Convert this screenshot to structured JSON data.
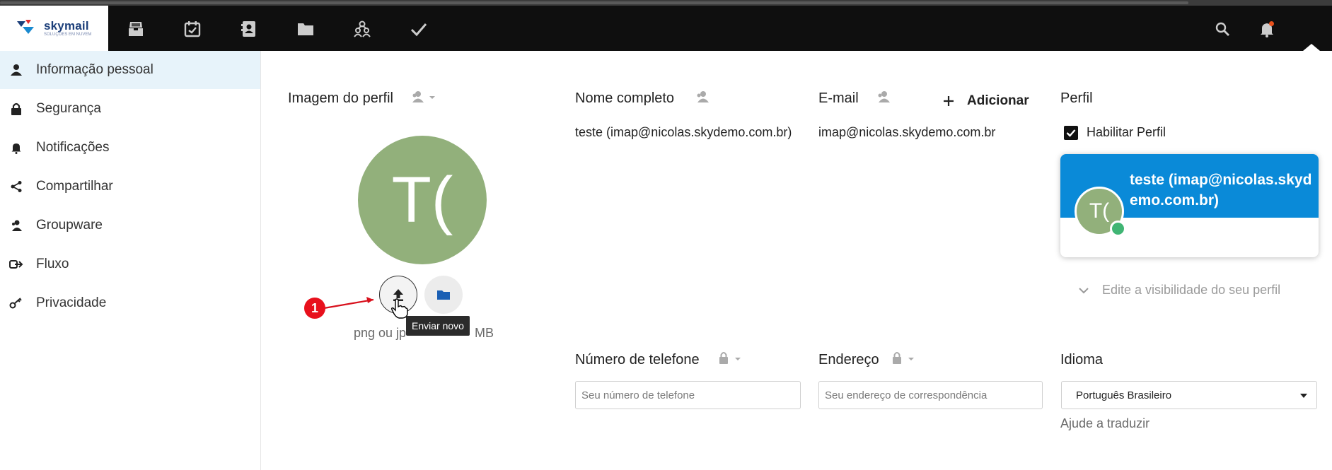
{
  "app": {
    "logo_text": "skymail",
    "logo_subtext": "SOLUÇÕES EM NUVEM"
  },
  "header": {
    "nav_icons": [
      "mail-icon",
      "calendar-icon",
      "contacts-icon",
      "files-icon",
      "groups-icon",
      "tasks-icon"
    ],
    "right_icons": [
      "search-icon",
      "notifications-icon"
    ],
    "notification_dot_color": "#e8511c"
  },
  "sidebar": {
    "items": [
      {
        "label": "Informação pessoal",
        "icon": "user-icon",
        "active": true
      },
      {
        "label": "Segurança",
        "icon": "lock-icon"
      },
      {
        "label": "Notificações",
        "icon": "bell-icon"
      },
      {
        "label": "Compartilhar",
        "icon": "share-icon"
      },
      {
        "label": "Groupware",
        "icon": "groupware-icon"
      },
      {
        "label": "Fluxo",
        "icon": "flow-icon"
      },
      {
        "label": "Privacidade",
        "icon": "key-icon"
      }
    ]
  },
  "profile_image": {
    "label": "Imagem do perfil",
    "avatar_initials": "T(",
    "avatar_color": "#92b07b",
    "upload_tooltip": "Enviar novo",
    "hint_left": "png ou jp",
    "hint_right": "MB",
    "annotation_number": "1"
  },
  "full_name": {
    "label": "Nome completo",
    "value": "teste (imap@nicolas.skydemo.com.br)"
  },
  "email": {
    "label": "E-mail",
    "add_label": "Adicionar",
    "value": "imap@nicolas.skydemo.com.br"
  },
  "profile": {
    "label": "Perfil",
    "enable_label": "Habilitar Perfil",
    "enabled": true,
    "card_name": "teste (imap@nicolas.skydemo.com.br)",
    "card_initials": "T(",
    "card_color": "#0a8ad8",
    "visibility_link": "Edite a visibilidade do seu perfil"
  },
  "phone": {
    "label": "Número de telefone",
    "placeholder": "Seu número de telefone"
  },
  "address": {
    "label": "Endereço",
    "placeholder": "Seu endereço de correspondência"
  },
  "language": {
    "label": "Idioma",
    "selected": "Português Brasileiro",
    "help_link": "Ajude a traduzir"
  }
}
